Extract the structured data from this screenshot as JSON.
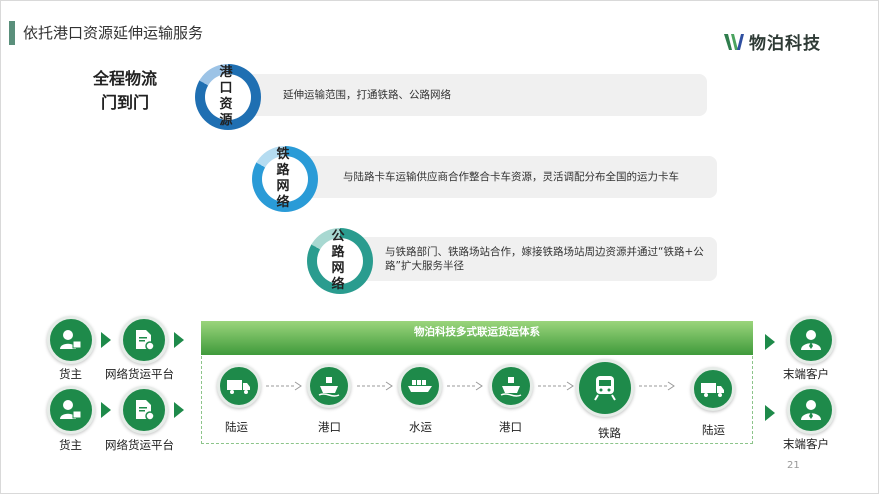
{
  "slide": {
    "title": "依托港口资源延伸运输服务",
    "page_number": "21"
  },
  "logo": {
    "text": "物泊科技",
    "icon": "w-leaf-logo-icon"
  },
  "headline": {
    "line1": "全程物流",
    "line2": "门到门"
  },
  "services": [
    {
      "badge_line1": "港口",
      "badge_line2": "资源",
      "text": "延伸运输范围，打通铁路、公路网络",
      "color": "#1f6fb2"
    },
    {
      "badge_line1": "铁路",
      "badge_line2": "网络",
      "text": "与陆路卡车运输供应商合作整合卡车资源，灵活调配分布全国的运力卡车",
      "color": "#2a9bd7"
    },
    {
      "badge_line1": "公路",
      "badge_line2": "网络",
      "text": "与铁路部门、铁路场站合作，嫁接铁路场站周边资源并通过“铁路+公路”扩大服务半径",
      "color": "#2a9c8f"
    }
  ],
  "left_nodes": [
    {
      "shipper": "货主",
      "platform": "网络货运平台"
    },
    {
      "shipper": "货主",
      "platform": "网络货运平台"
    }
  ],
  "platform": {
    "title": "物泊科技多式联运货运体系",
    "steps": [
      {
        "label": "陆运",
        "icon": "truck-icon"
      },
      {
        "label": "港口",
        "icon": "port-ship-icon"
      },
      {
        "label": "水运",
        "icon": "cargo-ship-icon"
      },
      {
        "label": "港口",
        "icon": "port-ship-icon"
      },
      {
        "label": "铁路",
        "icon": "train-icon"
      },
      {
        "label": "陆运",
        "icon": "truck-icon"
      }
    ]
  },
  "right_nodes": [
    {
      "label": "末端客户"
    },
    {
      "label": "末端客户"
    }
  ],
  "colors": {
    "green": "#1e8a4a",
    "accent": "#5a8f7b"
  }
}
